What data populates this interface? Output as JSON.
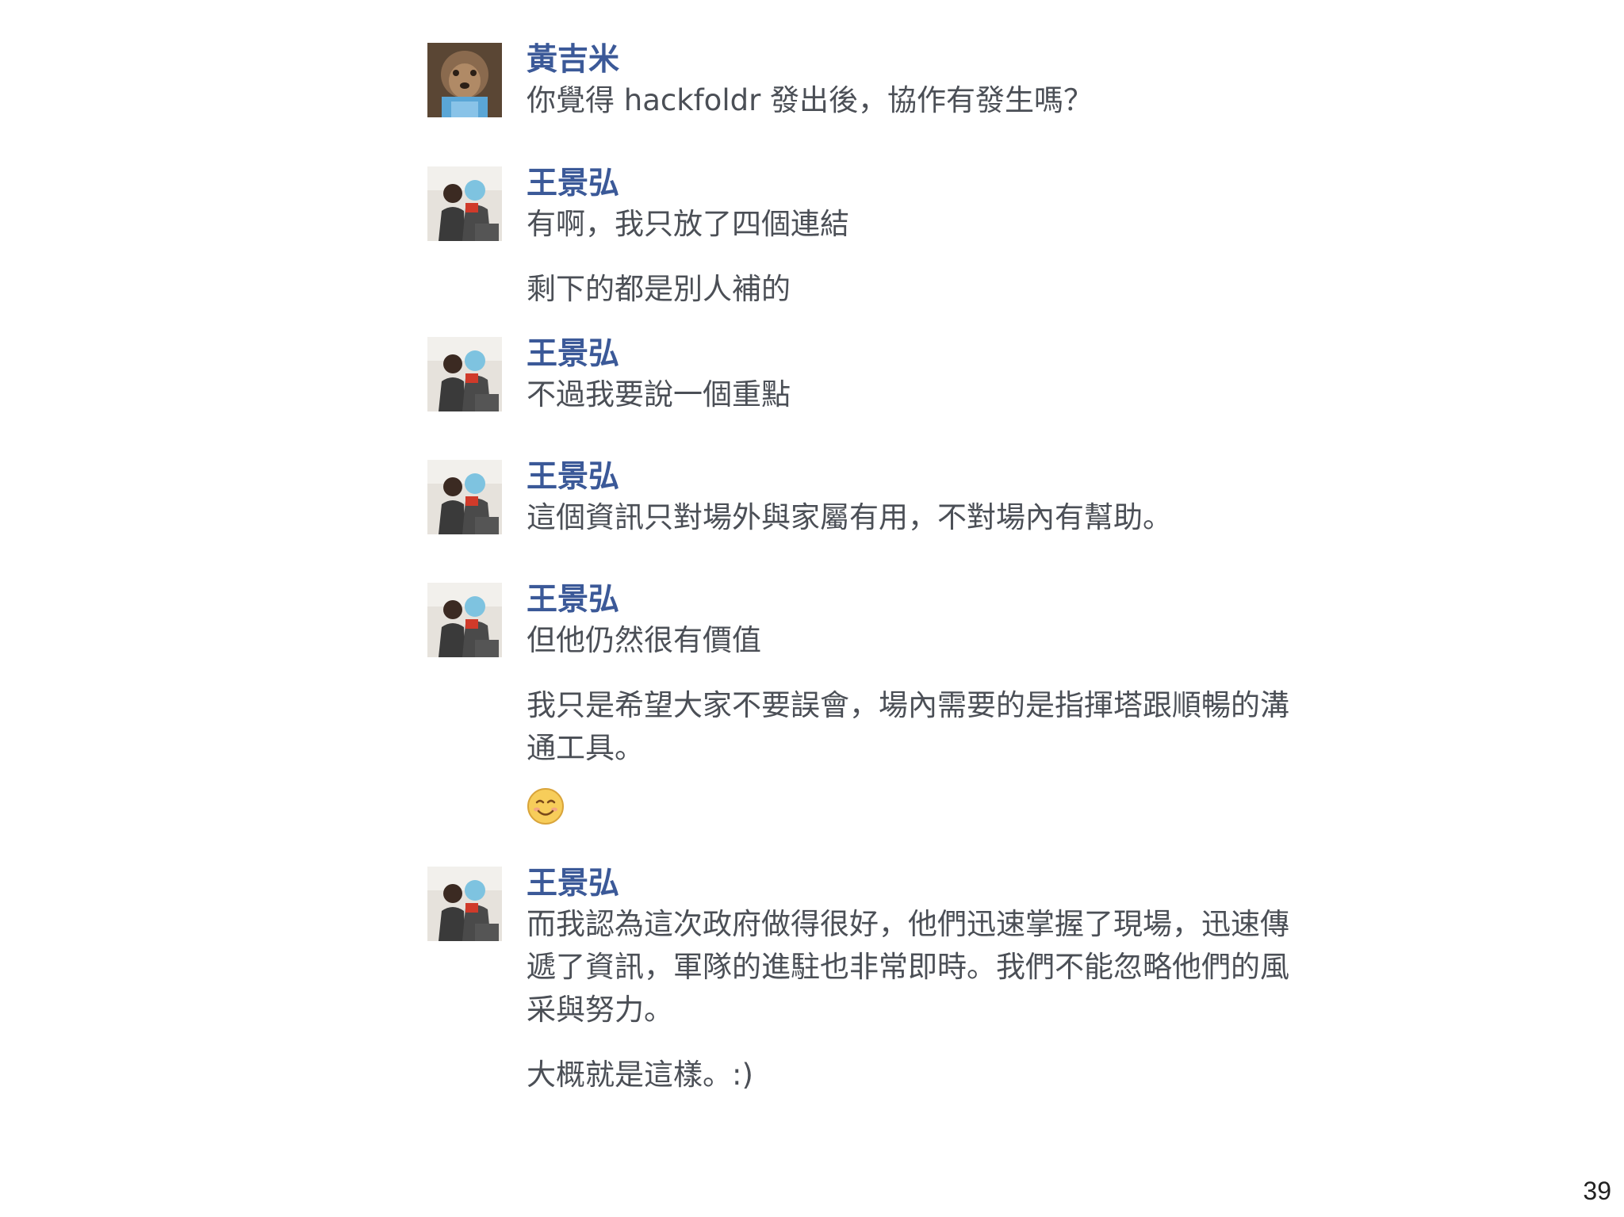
{
  "messages": [
    {
      "author": "黃吉米",
      "avatar": "avatar-dog-icon",
      "texts": [
        "你覺得 hackfoldr 發出後，協作有發生嗎？"
      ]
    },
    {
      "author": "王景弘",
      "avatar": "avatar-people-icon",
      "texts": [
        "有啊，我只放了四個連結",
        "剩下的都是別人補的"
      ]
    },
    {
      "author": "王景弘",
      "avatar": "avatar-people-icon",
      "texts": [
        "不過我要說一個重點"
      ]
    },
    {
      "author": "王景弘",
      "avatar": "avatar-people-icon",
      "texts": [
        "這個資訊只對場外與家屬有用，不對場內有幫助。"
      ]
    },
    {
      "author": "王景弘",
      "avatar": "avatar-people-icon",
      "texts": [
        "但他仍然很有價值",
        "我只是希望大家不要誤會，場內需要的是指揮塔跟順暢的溝通工具。"
      ],
      "emoji": "smiling-face-emoji"
    },
    {
      "author": "王景弘",
      "avatar": "avatar-people-icon",
      "texts": [
        "而我認為這次政府做得很好，他們迅速掌握了現場，迅速傳遞了資訊，軍隊的進駐也非常即時。我們不能忽略他們的風采與努力。",
        "大概就是這樣。:)"
      ]
    }
  ],
  "page_number": "39",
  "colors": {
    "author": "#3b5998",
    "text": "#4b4f56"
  }
}
